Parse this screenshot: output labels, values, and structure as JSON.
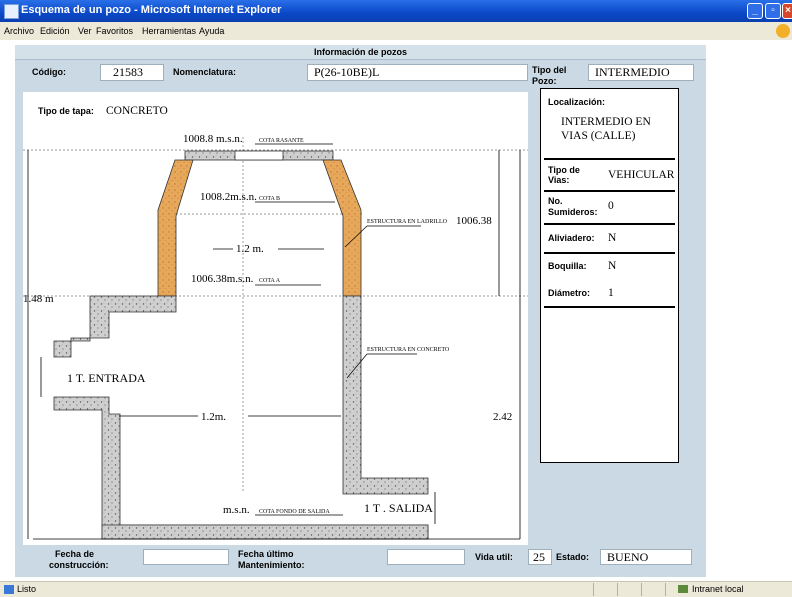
{
  "window": {
    "title": "Esquema de un pozo - Microsoft Internet Explorer"
  },
  "menu": {
    "items": [
      "Archivo",
      "Edición",
      "Ver",
      "Favoritos",
      "Herramientas",
      "Ayuda"
    ]
  },
  "page": {
    "header": "Información de pozos"
  },
  "info": {
    "codigo_label": "Código:",
    "codigo_value": "21583",
    "nomenclatura_label": "Nomenclatura:",
    "nomenclatura_value": "P(26-10BE)L",
    "tipo_pozo_label": "Tipo del Pozo:",
    "tipo_pozo_value": "INTERMEDIO"
  },
  "diagram": {
    "tipo_tapa_label": "Tipo de tapa:",
    "tipo_tapa_value": "CONCRETO",
    "cota_rasante_value": "1008.8 m.s.n.",
    "cota_rasante_label": "COTA RASANTE",
    "cota_b_value": "1008.2m.s.n.",
    "cota_b_label": "COTA B",
    "estructura_ladrillo": "ESTRUCTURA EN LADRILLO",
    "right_height": "1006.38",
    "inner_width_top": "1.2 m.",
    "cota_a_value": "1006.38m.s.n.",
    "cota_a_label": "COTA A",
    "left_height": "1.48 m",
    "estructura_concreto": "ESTRUCTURA EN CONCRETO",
    "entrada": "1 T. ENTRADA",
    "inner_width_bottom": "1.2m.",
    "total_height": "2.42",
    "fondo_msn": "m.s.n.",
    "cota_fondo_label": "COTA FONDO DE SALIDA",
    "salida": "1 T . SALIDA"
  },
  "panel": {
    "localizacion_label": "Localización:",
    "localizacion_value_1": "INTERMEDIO EN",
    "localizacion_value_2": "VIAS (CALLE)",
    "tipo_vias_label_1": "Tipo de",
    "tipo_vias_label_2": "Vias:",
    "tipo_vias_value": "VEHICULAR",
    "sumideros_label_1": "No.",
    "sumideros_label_2": "Sumideros:",
    "sumideros_value": "0",
    "aliviadero_label": "Aliviadero:",
    "aliviadero_value": "N",
    "boquilla_label": "Boquilla:",
    "boquilla_value": "N",
    "diametro_label": "Diámetro:",
    "diametro_value": "1"
  },
  "footer": {
    "fecha_construccion_label_1": "Fecha de",
    "fecha_construccion_label_2": "construcción:",
    "fecha_construccion_value": "",
    "fecha_mant_label_1": "Fecha último",
    "fecha_mant_label_2": "Mantenimiento:",
    "fecha_mant_value": "",
    "vida_util_label": "Vida util:",
    "vida_util_value": "25",
    "estado_label": "Estado:",
    "estado_value": "BUENO"
  },
  "status": {
    "left": "Listo",
    "zone": "Intranet local"
  },
  "colors": {
    "page_bg": "#cad9e3",
    "titlebar": "#0a48c8",
    "brick": "#e8a85b",
    "concrete": "#c9c9c9"
  }
}
